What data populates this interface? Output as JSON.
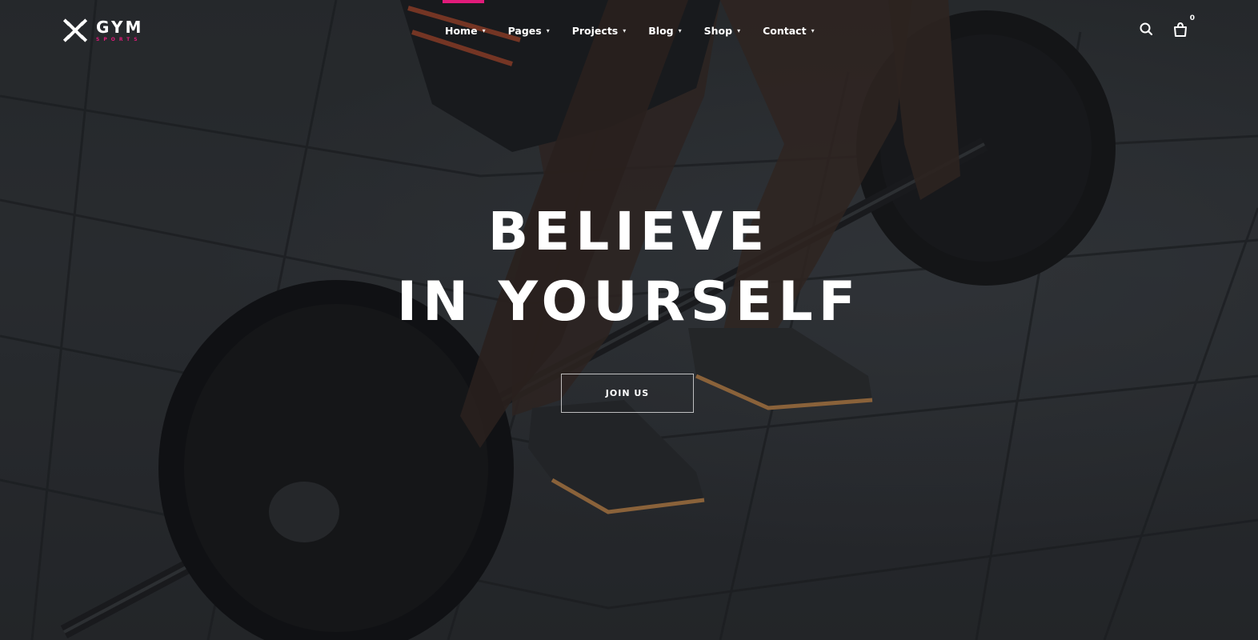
{
  "brand": {
    "name": "GYM",
    "subtitle": "SPORTS",
    "accent_color": "#e01b7a",
    "logo_icon": "crossed-dumbbells-icon"
  },
  "nav": {
    "items": [
      {
        "label": "Home",
        "has_dropdown": true
      },
      {
        "label": "Pages",
        "has_dropdown": true
      },
      {
        "label": "Projects",
        "has_dropdown": true
      },
      {
        "label": "Blog",
        "has_dropdown": true
      },
      {
        "label": "Shop",
        "has_dropdown": true
      },
      {
        "label": "Contact",
        "has_dropdown": true
      }
    ],
    "caret_icon": "chevron-down-icon"
  },
  "tools": {
    "search_icon": "search-icon",
    "cart_icon": "shopping-bag-icon",
    "cart_count": "0"
  },
  "hero": {
    "headline_line1": "BELIEVE",
    "headline_line2": "IN YOURSELF",
    "cta_label": "JOIN US",
    "background_description_icon": "barbell-deadlift-photo"
  }
}
